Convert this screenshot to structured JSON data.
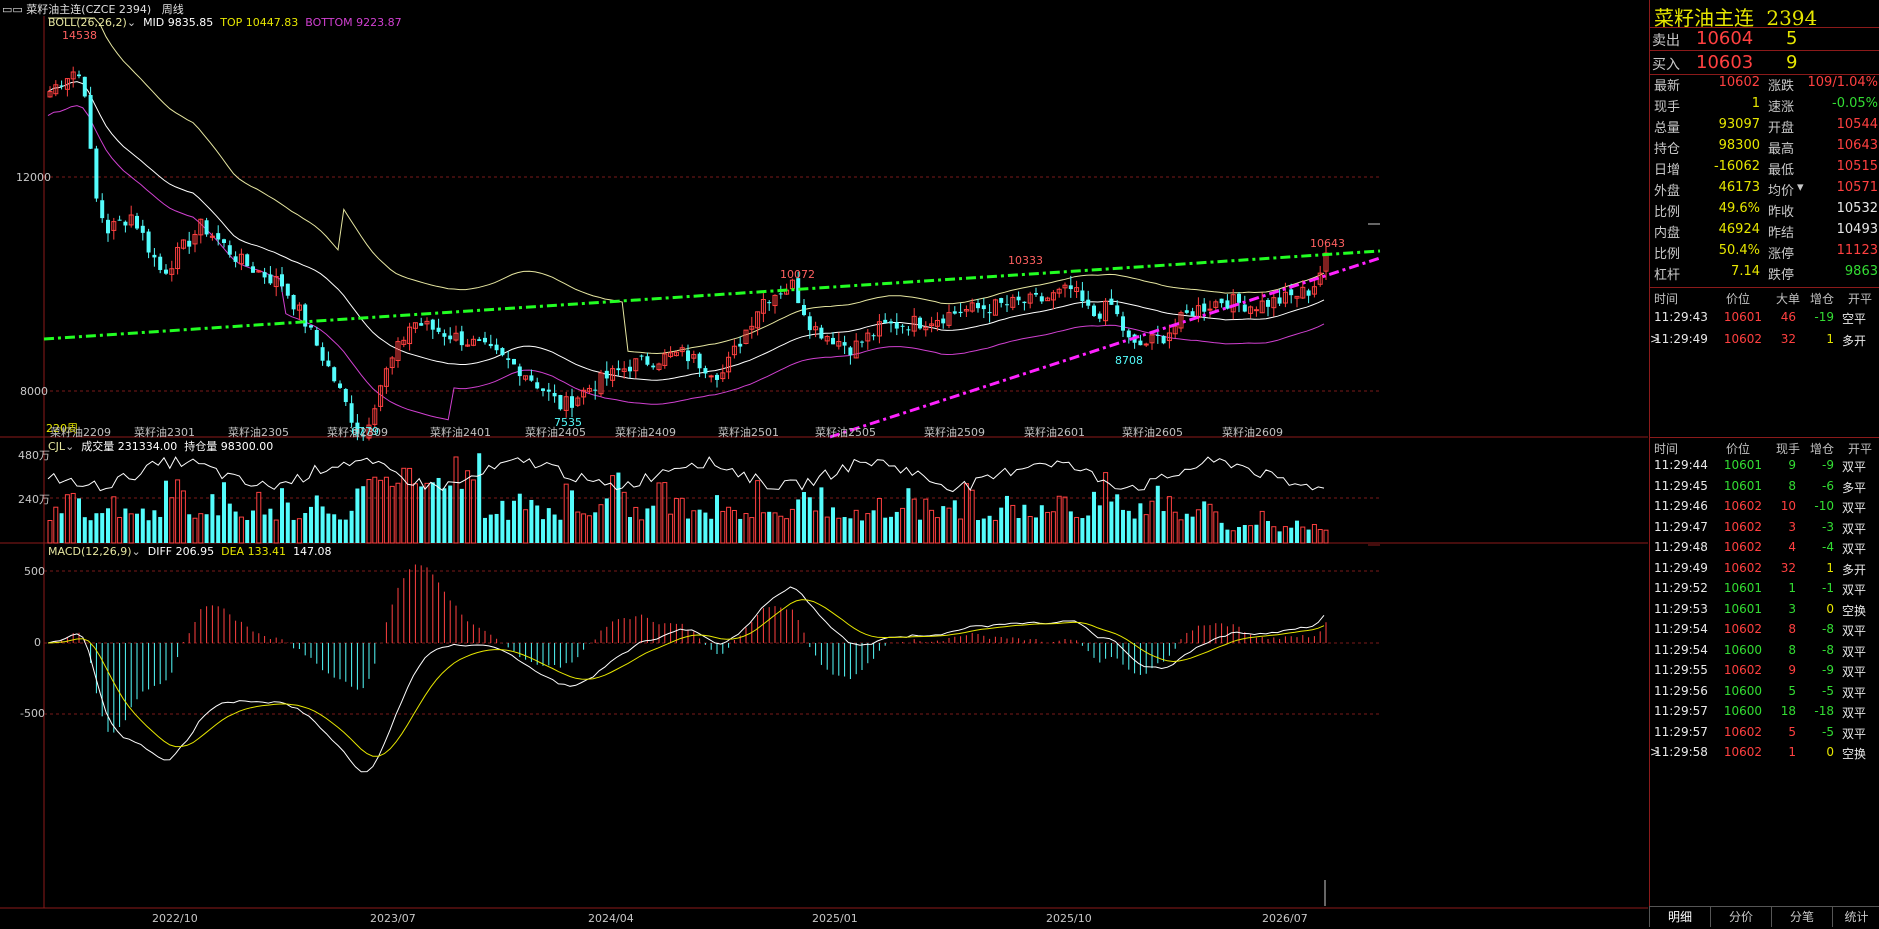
{
  "header": {
    "window_title": "菜籽油主连(CZCE 2394)",
    "period": "周线",
    "boll_label": "BOLL(26,26,2)",
    "mid": "MID 9835.85",
    "top": "TOP 10447.83",
    "bottom": "BOTTOM 9223.87"
  },
  "price_axis": {
    "labels": [
      "12000",
      "8000"
    ]
  },
  "price_annotations": {
    "high_2022": "14538",
    "low_2023": "6779",
    "low_2024": "7535",
    "p_10072": "10072",
    "p_10333": "10333",
    "p_8708": "8708",
    "last_high": "10643",
    "week_count": "220周"
  },
  "contract_labels": [
    "菜籽油2209",
    "菜籽油2301",
    "菜籽油2305",
    "菜籽油2309",
    "菜籽油2401",
    "菜籽油2405",
    "菜籽油2409",
    "菜籽油2501",
    "菜籽油2505",
    "菜籽油2509",
    "菜籽油2601",
    "菜籽油2605",
    "菜籽油2609"
  ],
  "volume_panel": {
    "label": "CJL",
    "vol": "成交量 231334.00",
    "oi": "持仓量 98300.00",
    "axis": [
      "480万",
      "240万"
    ]
  },
  "macd_panel": {
    "label": "MACD(12,26,9)",
    "diff": "DIFF 206.95",
    "dea": "DEA 133.41",
    "macd": "147.08",
    "axis": [
      "500",
      "0",
      "-500"
    ]
  },
  "date_axis": [
    "2022/10",
    "2023/07",
    "2024/04",
    "2025/01",
    "2025/10",
    "2026/07"
  ],
  "quote": {
    "name": "菜籽油主连",
    "code": "2394",
    "sell_label": "卖出",
    "sell_price": "10604",
    "sell_vol": "5",
    "buy_label": "买入",
    "buy_price": "10603",
    "buy_vol": "9",
    "rows": [
      {
        "l1": "最新",
        "v1": "10602",
        "c1": "red",
        "l2": "涨跌",
        "v2": "109/1.04%",
        "c2": "red"
      },
      {
        "l1": "现手",
        "v1": "1",
        "c1": "yellow",
        "l2": "速涨",
        "v2": "-0.05%",
        "c2": "green"
      },
      {
        "l1": "总量",
        "v1": "93097",
        "c1": "yellow",
        "l2": "开盘",
        "v2": "10544",
        "c2": "red"
      },
      {
        "l1": "持仓",
        "v1": "98300",
        "c1": "yellow",
        "l2": "最高",
        "v2": "10643",
        "c2": "red"
      },
      {
        "l1": "日增",
        "v1": "-16062",
        "c1": "yellow",
        "l2": "最低",
        "v2": "10515",
        "c2": "red"
      },
      {
        "l1": "外盘",
        "v1": "46173",
        "c1": "yellow",
        "l2": "均价",
        "v2": "10571",
        "c2": "red"
      },
      {
        "l1": "比例",
        "v1": "49.6%",
        "c1": "yellow",
        "l2": "昨收",
        "v2": "10532",
        "c2": "white"
      },
      {
        "l1": "内盘",
        "v1": "46924",
        "c1": "yellow",
        "l2": "昨结",
        "v2": "10493",
        "c2": "white"
      },
      {
        "l1": "比例",
        "v1": "50.4%",
        "c1": "yellow",
        "l2": "涨停",
        "v2": "11123",
        "c2": "red"
      },
      {
        "l1": "杠杆",
        "v1": "7.14",
        "c1": "yellow",
        "l2": "跌停",
        "v2": "9863",
        "c2": "green"
      }
    ],
    "avg_arrow": "▾"
  },
  "big_trades": {
    "headers": [
      "时间",
      "价位",
      "大单",
      "增仓",
      "开平"
    ],
    "rows": [
      {
        "t": "11:29:43",
        "p": "10601",
        "v": "46",
        "d": "-19",
        "k": "空平",
        "pc": "red",
        "dc": "green"
      },
      {
        "t": "11:29:49",
        "p": "10602",
        "v": "32",
        "d": "1",
        "k": "多开",
        "pc": "red",
        "dc": "yellow",
        "mark": ">"
      }
    ]
  },
  "ticks": {
    "headers": [
      "时间",
      "价位",
      "现手",
      "增仓",
      "开平"
    ],
    "rows": [
      {
        "t": "11:29:44",
        "p": "10601",
        "v": "9",
        "d": "-9",
        "k": "双平",
        "vc": "green"
      },
      {
        "t": "11:29:45",
        "p": "10601",
        "v": "8",
        "d": "-6",
        "k": "多平",
        "vc": "green"
      },
      {
        "t": "11:29:46",
        "p": "10602",
        "v": "10",
        "d": "-10",
        "k": "双平",
        "vc": "red"
      },
      {
        "t": "11:29:47",
        "p": "10602",
        "v": "3",
        "d": "-3",
        "k": "双平",
        "vc": "red"
      },
      {
        "t": "11:29:48",
        "p": "10602",
        "v": "4",
        "d": "-4",
        "k": "双平",
        "vc": "red"
      },
      {
        "t": "11:29:49",
        "p": "10602",
        "v": "32",
        "d": "1",
        "k": "多开",
        "vc": "red"
      },
      {
        "t": "11:29:52",
        "p": "10601",
        "v": "1",
        "d": "-1",
        "k": "双平",
        "vc": "green"
      },
      {
        "t": "11:29:53",
        "p": "10601",
        "v": "3",
        "d": "0",
        "k": "空换",
        "vc": "green"
      },
      {
        "t": "11:29:54",
        "p": "10602",
        "v": "8",
        "d": "-8",
        "k": "双平",
        "vc": "red"
      },
      {
        "t": "11:29:54",
        "p": "10600",
        "v": "8",
        "d": "-8",
        "k": "双平",
        "vc": "green"
      },
      {
        "t": "11:29:55",
        "p": "10602",
        "v": "9",
        "d": "-9",
        "k": "双平",
        "vc": "red"
      },
      {
        "t": "11:29:56",
        "p": "10600",
        "v": "5",
        "d": "-5",
        "k": "双平",
        "vc": "green"
      },
      {
        "t": "11:29:57",
        "p": "10600",
        "v": "18",
        "d": "-18",
        "k": "双平",
        "vc": "green"
      },
      {
        "t": "11:29:57",
        "p": "10602",
        "v": "5",
        "d": "-5",
        "k": "双平",
        "vc": "red"
      },
      {
        "t": "11:29:58",
        "p": "10602",
        "v": "1",
        "d": "0",
        "k": "空换",
        "vc": "red",
        "mark": ">"
      }
    ]
  },
  "tabs": [
    "明细",
    "分价",
    "分笔",
    "统计"
  ],
  "colors": {
    "up": "#ff4040",
    "down": "#54fcfc",
    "boll_upper": "#e6e6a0",
    "boll_mid": "#ffffff",
    "boll_lower": "#d040d0",
    "trend_green": "#22ff22",
    "trend_magenta": "#ff22ff",
    "grid": "#8b1a1a"
  }
}
